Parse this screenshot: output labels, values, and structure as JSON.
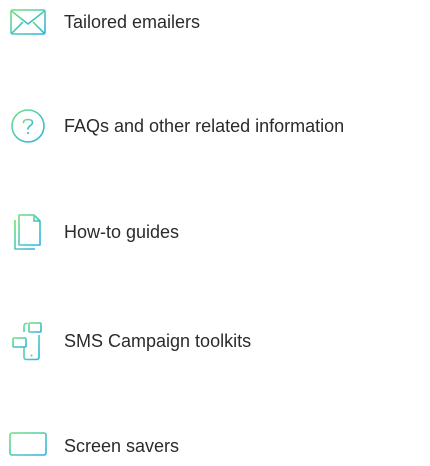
{
  "items": [
    {
      "label": "Tailored emailers",
      "icon": "envelope-icon"
    },
    {
      "label": "FAQs and other related information",
      "icon": "question-circle-icon"
    },
    {
      "label": "How-to guides",
      "icon": "document-icon"
    },
    {
      "label": "SMS Campaign toolkits",
      "icon": "phone-message-icon"
    },
    {
      "label": "Screen savers",
      "icon": "monitor-icon"
    }
  ],
  "colors": {
    "icon_gradient_start": "#6fe07e",
    "icon_gradient_end": "#2bb3e6",
    "text": "#2b2b2b"
  }
}
